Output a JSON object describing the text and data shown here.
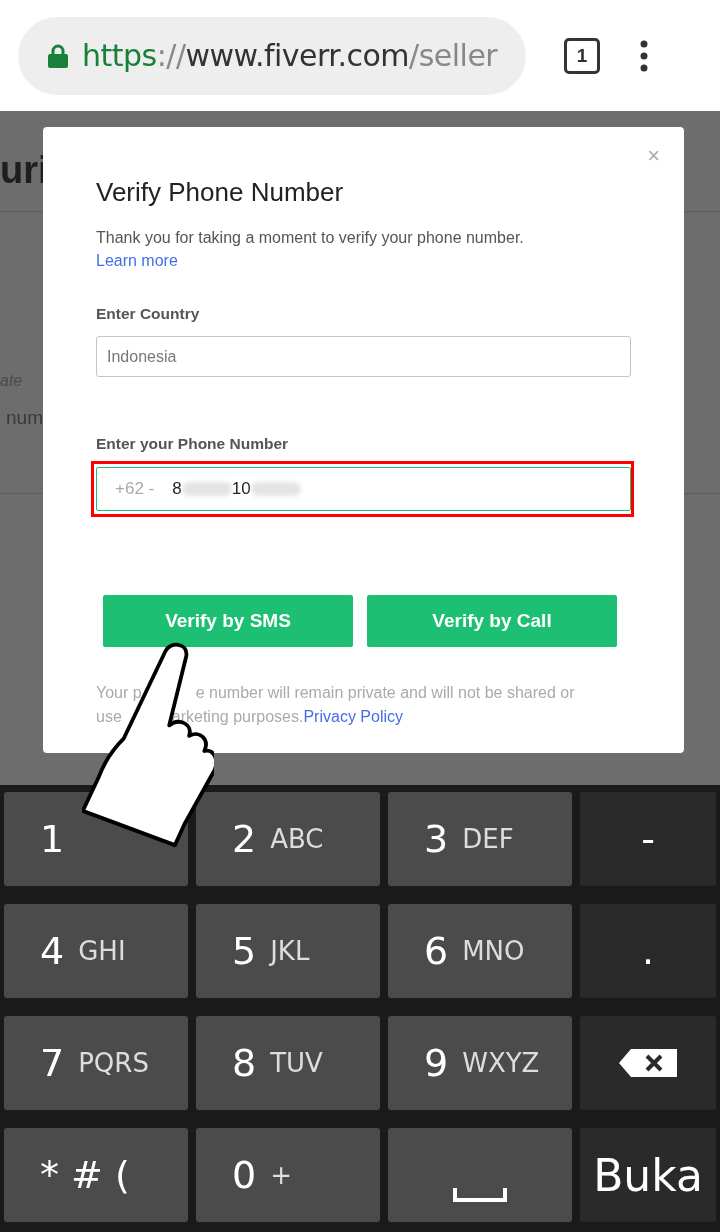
{
  "browser": {
    "url": {
      "scheme": "https",
      "separator": "://",
      "host": "www.fiverr.com",
      "path": "/seller"
    },
    "tab_count": "1"
  },
  "background_page": {
    "heading": "uri",
    "label": "ate",
    "text": "num"
  },
  "dialog": {
    "close": "×",
    "title": "Verify Phone Number",
    "description": "Thank you for taking a moment to verify your phone number.",
    "learn_more": "Learn more",
    "country": {
      "label": "Enter Country",
      "value": "Indonesia"
    },
    "phone": {
      "label": "Enter your Phone Number",
      "prefix": "+62 -",
      "highlighted": true,
      "value_parts": [
        {
          "kind": "text",
          "text": "8"
        },
        {
          "kind": "blur"
        },
        {
          "kind": "text",
          "text": "10"
        },
        {
          "kind": "blur"
        }
      ]
    },
    "buttons": [
      "Verify by SMS",
      "Verify by Call"
    ],
    "disclaimer_lines": [
      [
        "Your p",
        "e number will remain private and will not be shared or"
      ],
      [
        "use",
        "arketing purposes."
      ]
    ],
    "privacy_link": "Privacy Policy"
  },
  "keyboard": {
    "rows": [
      [
        {
          "kind": "digit",
          "main": "1"
        },
        {
          "kind": "digit",
          "main": "2",
          "sub": "ABC"
        },
        {
          "kind": "digit",
          "main": "3",
          "sub": "DEF"
        },
        {
          "kind": "symbol",
          "main": "-"
        }
      ],
      [
        {
          "kind": "digit",
          "main": "4",
          "sub": "GHI"
        },
        {
          "kind": "digit",
          "main": "5",
          "sub": "JKL"
        },
        {
          "kind": "digit",
          "main": "6",
          "sub": "MNO"
        },
        {
          "kind": "symbol",
          "main": "."
        }
      ],
      [
        {
          "kind": "digit",
          "main": "7",
          "sub": "PQRS"
        },
        {
          "kind": "digit",
          "main": "8",
          "sub": "TUV"
        },
        {
          "kind": "digit",
          "main": "9",
          "sub": "WXYZ"
        },
        {
          "kind": "backspace"
        }
      ],
      [
        {
          "kind": "digit",
          "main": "* # ("
        },
        {
          "kind": "digit",
          "main": "0",
          "sub": "+"
        },
        {
          "kind": "space"
        },
        {
          "kind": "action",
          "main": "Buka"
        }
      ]
    ]
  }
}
